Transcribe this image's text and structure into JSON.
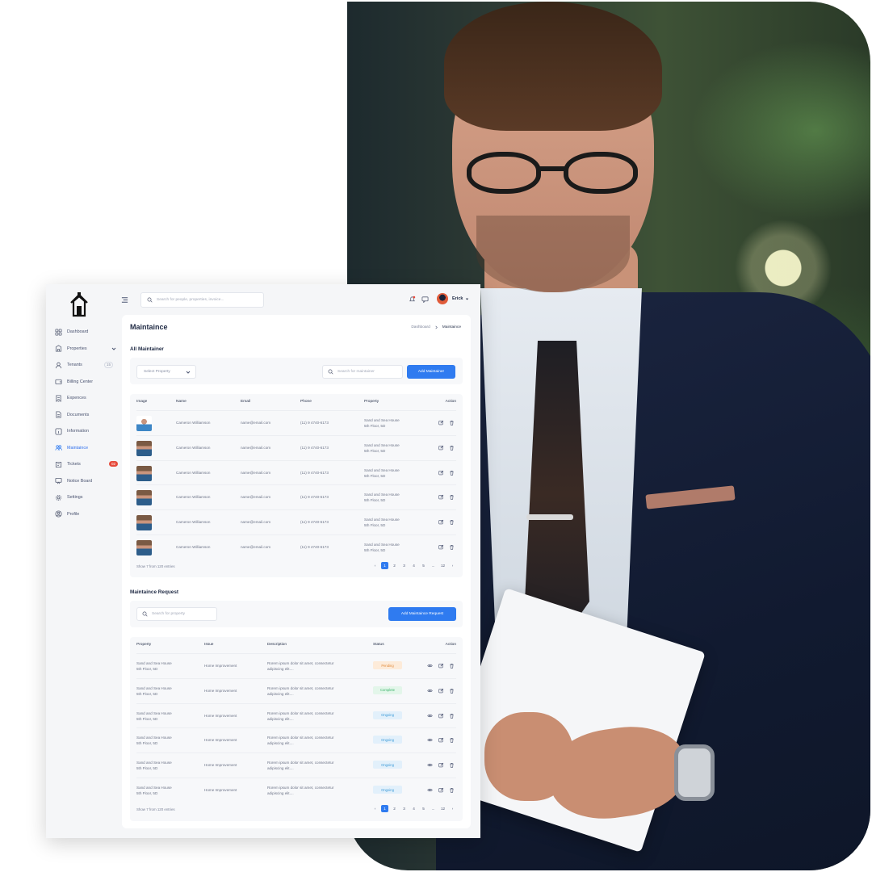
{
  "sidebar": {
    "items": [
      {
        "label": "Dashboard",
        "icon": "grid-icon"
      },
      {
        "label": "Properties",
        "icon": "building-icon"
      },
      {
        "label": "Tenants",
        "icon": "user-icon",
        "count": "15"
      },
      {
        "label": "Billing Center",
        "icon": "wallet-icon"
      },
      {
        "label": "Expences",
        "icon": "receipt-icon"
      },
      {
        "label": "Documents",
        "icon": "document-icon"
      },
      {
        "label": "Information",
        "icon": "info-icon"
      },
      {
        "label": "Maintaince",
        "icon": "users-icon"
      },
      {
        "label": "Tickets",
        "icon": "ticket-icon",
        "badge": "02"
      },
      {
        "label": "Notice Board",
        "icon": "board-icon"
      },
      {
        "label": "Settings",
        "icon": "gear-icon"
      },
      {
        "label": "Profile",
        "icon": "profile-icon"
      }
    ],
    "active_index": 7
  },
  "topbar": {
    "search_placeholder": "Search for people, properties, invoice...",
    "user_name": "Erick"
  },
  "page": {
    "title": "Maintaince",
    "breadcrumb": [
      "Dashboard",
      "Maintaince"
    ]
  },
  "maintainer": {
    "section_title": "All Maintainer",
    "select_placeholder": "Select Property",
    "search_placeholder": "Search for maintainer",
    "add_button": "Add Maintainer",
    "columns": [
      "Image",
      "Name",
      "Email",
      "Phone",
      "Property",
      "Action"
    ],
    "rows": [
      {
        "name": "Cameron Williamson",
        "email": "name@email.com",
        "phone": "(11) 9 4740-6173",
        "property": "Sand and Sea House",
        "address": "5th Floor, 5D"
      },
      {
        "name": "Cameron Williamson",
        "email": "name@email.com",
        "phone": "(11) 9 4740-6173",
        "property": "Sand and Sea House",
        "address": "5th Floor, 5D"
      },
      {
        "name": "Cameron Williamson",
        "email": "name@email.com",
        "phone": "(11) 9 4740-6173",
        "property": "Sand and Sea House",
        "address": "5th Floor, 5D"
      },
      {
        "name": "Cameron Williamson",
        "email": "name@email.com",
        "phone": "(11) 9 4740-6173",
        "property": "Sand and Sea House",
        "address": "5th Floor, 5D"
      },
      {
        "name": "Cameron Williamson",
        "email": "name@email.com",
        "phone": "(11) 9 4740-6173",
        "property": "Sand and Sea House",
        "address": "5th Floor, 5D"
      },
      {
        "name": "Cameron Williamson",
        "email": "name@email.com",
        "phone": "(11) 9 4740-6173",
        "property": "Sand and Sea House",
        "address": "5th Floor, 5D"
      }
    ],
    "footer_info": "Show 7 from 120 entries",
    "pages": [
      "1",
      "2",
      "3",
      "4",
      "5",
      "...",
      "12"
    ]
  },
  "requests": {
    "section_title": "Maintaince Request",
    "search_placeholder": "Search for property",
    "add_button": "Add Maintaince Request",
    "columns": [
      "Property",
      "Issue",
      "Description",
      "Status",
      "Action"
    ],
    "rows": [
      {
        "property": "Sand and Sea House",
        "address": "5th Floor, 5D",
        "issue": "Home Improvement",
        "desc1": "Rorem ipsum dolor sit amet, consectetur",
        "desc2": "adipiscing elit....",
        "status": "Pending",
        "status_type": "pending"
      },
      {
        "property": "Sand and Sea House",
        "address": "5th Floor, 5D",
        "issue": "Home Improvement",
        "desc1": "Rorem ipsum dolor sit amet, consectetur",
        "desc2": "adipiscing elit....",
        "status": "Complete",
        "status_type": "complete"
      },
      {
        "property": "Sand and Sea House",
        "address": "5th Floor, 5D",
        "issue": "Home Improvement",
        "desc1": "Rorem ipsum dolor sit amet, consectetur",
        "desc2": "adipiscing elit....",
        "status": "Ongoing",
        "status_type": "ongoing"
      },
      {
        "property": "Sand and Sea House",
        "address": "5th Floor, 5D",
        "issue": "Home Improvement",
        "desc1": "Rorem ipsum dolor sit amet, consectetur",
        "desc2": "adipiscing elit....",
        "status": "Ongoing",
        "status_type": "ongoing"
      },
      {
        "property": "Sand and Sea House",
        "address": "5th Floor, 5D",
        "issue": "Home Improvement",
        "desc1": "Rorem ipsum dolor sit amet, consectetur",
        "desc2": "adipiscing elit....",
        "status": "Ongoing",
        "status_type": "ongoing"
      },
      {
        "property": "Sand and Sea House",
        "address": "5th Floor, 5D",
        "issue": "Home Improvement",
        "desc1": "Rorem ipsum dolor sit amet, consectetur",
        "desc2": "adipiscing elit....",
        "status": "Ongoing",
        "status_type": "ongoing"
      }
    ],
    "footer_info": "Show 7 from 120 entries",
    "pages": [
      "1",
      "2",
      "3",
      "4",
      "5",
      "...",
      "12"
    ]
  },
  "colors": {
    "accent": "#2f7bf0",
    "badge": "#e64b3c",
    "pending": "#e08a3c",
    "complete": "#3bb36a",
    "ongoing": "#3d9bd8"
  }
}
